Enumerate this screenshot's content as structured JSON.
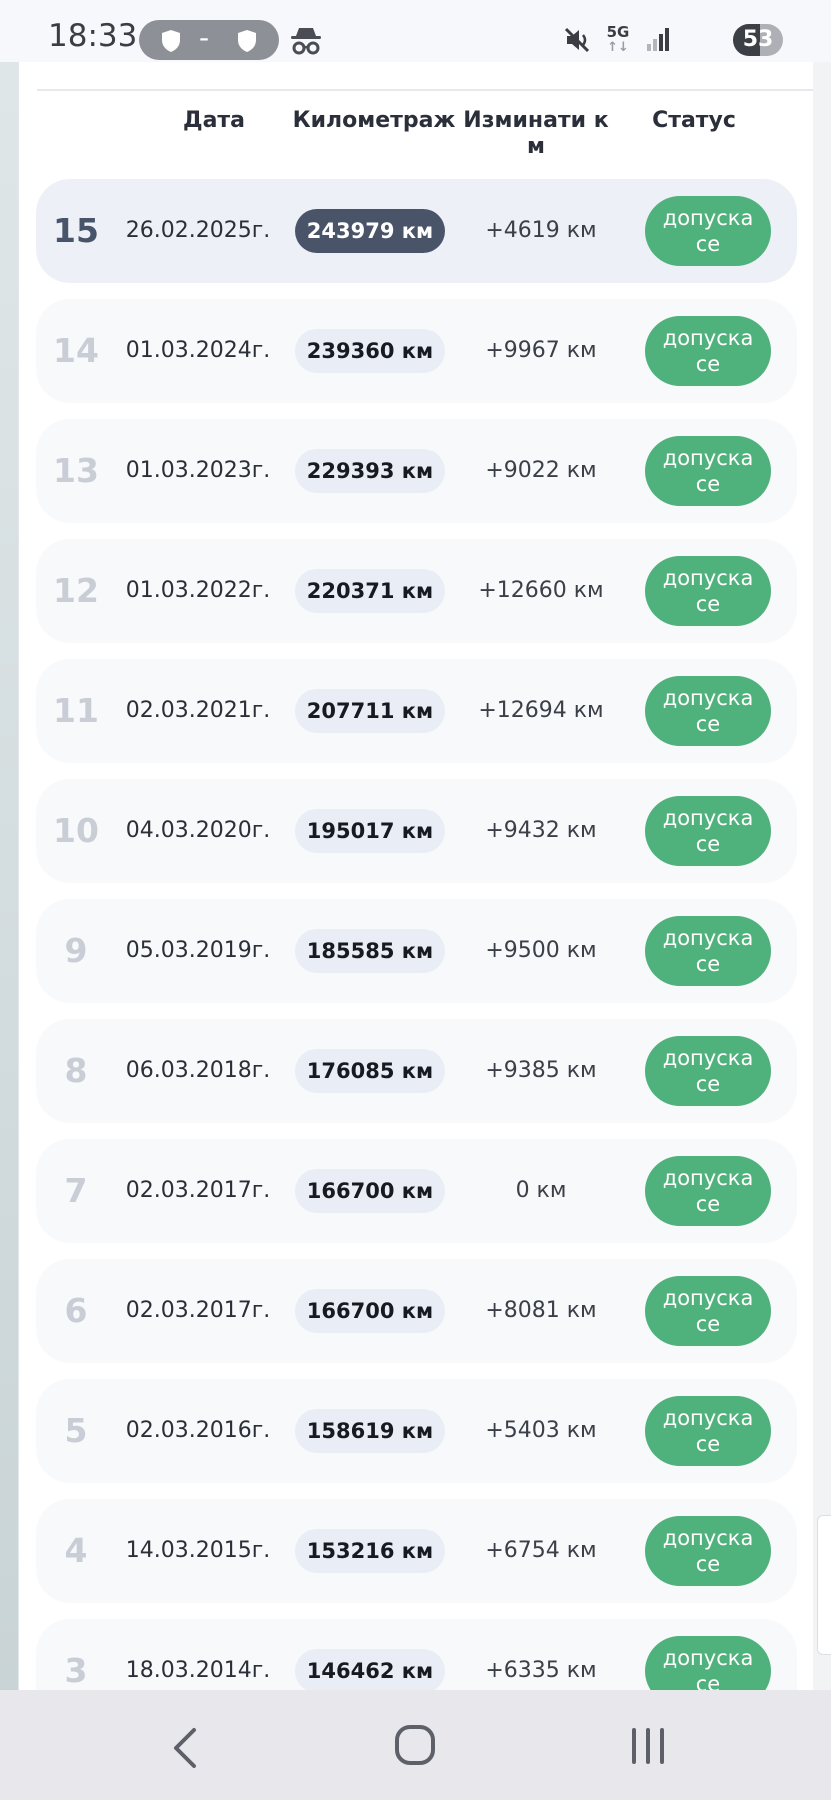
{
  "status_bar": {
    "time": "18:33",
    "vpn_separator": "-",
    "network": "5G",
    "battery": "53",
    "battery_level": 0.53
  },
  "table": {
    "headers": {
      "date": "Дата",
      "mileage": "Километраж",
      "diff": "Изминати км",
      "status": "Статус"
    },
    "rows": [
      {
        "num": "15",
        "date": "26.02.2025г.",
        "mileage": "243979 км",
        "diff": "+4619 км",
        "status": "допуска се",
        "current": true
      },
      {
        "num": "14",
        "date": "01.03.2024г.",
        "mileage": "239360 км",
        "diff": "+9967 км",
        "status": "допуска се"
      },
      {
        "num": "13",
        "date": "01.03.2023г.",
        "mileage": "229393 км",
        "diff": "+9022 км",
        "status": "допуска се"
      },
      {
        "num": "12",
        "date": "01.03.2022г.",
        "mileage": "220371 км",
        "diff": "+12660 км",
        "status": "допуска се"
      },
      {
        "num": "11",
        "date": "02.03.2021г.",
        "mileage": "207711 км",
        "diff": "+12694 км",
        "status": "допуска се"
      },
      {
        "num": "10",
        "date": "04.03.2020г.",
        "mileage": "195017 км",
        "diff": "+9432 км",
        "status": "допуска се"
      },
      {
        "num": "9",
        "date": "05.03.2019г.",
        "mileage": "185585 км",
        "diff": "+9500 км",
        "status": "допуска се"
      },
      {
        "num": "8",
        "date": "06.03.2018г.",
        "mileage": "176085 км",
        "diff": "+9385 км",
        "status": "допуска се"
      },
      {
        "num": "7",
        "date": "02.03.2017г.",
        "mileage": "166700 км",
        "diff": "0 км",
        "status": "допуска се"
      },
      {
        "num": "6",
        "date": "02.03.2017г.",
        "mileage": "166700 км",
        "diff": "+8081 км",
        "status": "допуска се"
      },
      {
        "num": "5",
        "date": "02.03.2016г.",
        "mileage": "158619 км",
        "diff": "+5403 км",
        "status": "допуска се"
      },
      {
        "num": "4",
        "date": "14.03.2015г.",
        "mileage": "153216 км",
        "diff": "+6754 км",
        "status": "допуска се"
      },
      {
        "num": "3",
        "date": "18.03.2014г.",
        "mileage": "146462 км",
        "diff": "+6335 км",
        "status": "допуска се"
      }
    ]
  },
  "colors": {
    "status_green": "#4fb17c",
    "current_badge": "#4a5468",
    "badge_light": "#e9eef6"
  },
  "icons": {
    "vpn": "shield-icon",
    "incognito": "incognito-icon",
    "mute": "mute-icon",
    "network": "5g-icon",
    "signal": "signal-icon",
    "nav_back": "back-icon",
    "nav_home": "home-icon",
    "nav_recent": "recent-apps-icon"
  }
}
